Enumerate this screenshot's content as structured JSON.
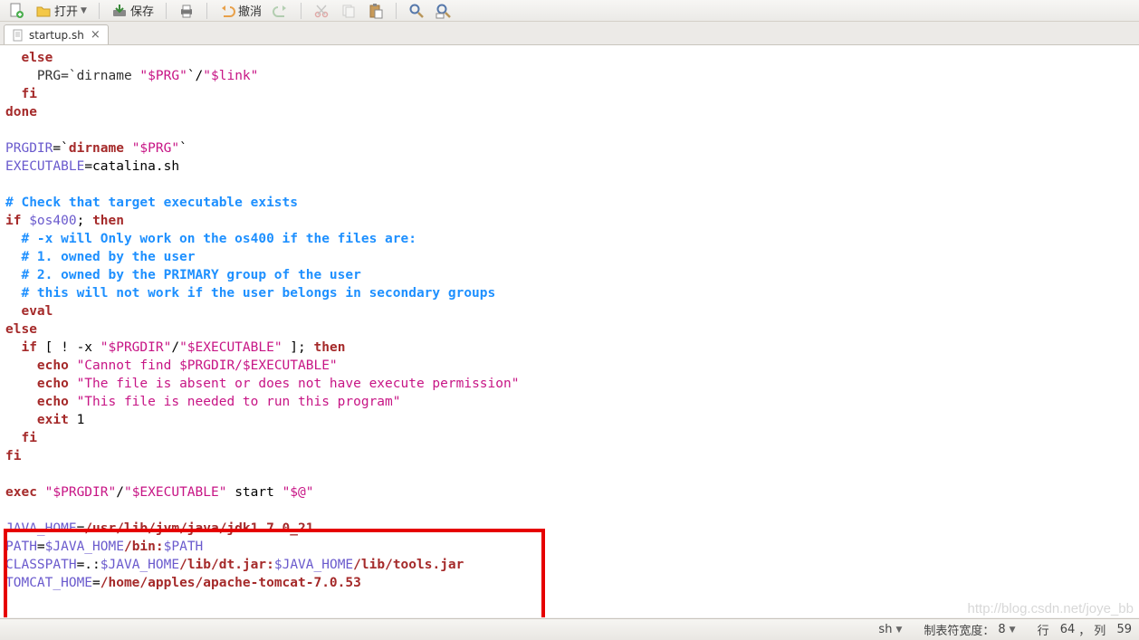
{
  "toolbar": {
    "open_label": "打开",
    "save_label": "保存",
    "undo_label": "撤消"
  },
  "tab": {
    "filename": "startup.sh"
  },
  "code": {
    "l1": "  else",
    "l2_a": "    PRG=`",
    "l2_b": "dirname",
    "l2_c": " ",
    "l2_d": "\"$PRG\"",
    "l2_e": "`/",
    "l2_f": "\"$link\"",
    "l3": "  fi",
    "l4": "done",
    "l5_a": "PRGDIR",
    "l5_b": "=`",
    "l5_c": "dirname",
    "l5_d": " ",
    "l5_e": "\"$PRG\"",
    "l5_f": "`",
    "l6_a": "EXECUTABLE",
    "l6_b": "=catalina.sh",
    "c1": "# Check that target executable exists",
    "l7_a": "if",
    "l7_b": " ",
    "l7_c": "$os400",
    "l7_d": "; ",
    "l7_e": "then",
    "c2": "  # -x will Only work on the os400 if the files are:",
    "c3": "  # 1. owned by the user",
    "c4": "  # 2. owned by the PRIMARY group of the user",
    "c5": "  # this will not work if the user belongs in secondary groups",
    "l8": "  eval",
    "l9": "else",
    "l10_a": "  if",
    "l10_b": " [ ! -x ",
    "l10_c": "\"$PRGDIR\"",
    "l10_d": "/",
    "l10_e": "\"$EXECUTABLE\"",
    "l10_f": " ]; ",
    "l10_g": "then",
    "l11_a": "    echo",
    "l11_b": " ",
    "l11_c": "\"Cannot find $PRGDIR/$EXECUTABLE\"",
    "l12_a": "    echo",
    "l12_b": " ",
    "l12_c": "\"The file is absent or does not have execute permission\"",
    "l13_a": "    echo",
    "l13_b": " ",
    "l13_c": "\"This file is needed to run this program\"",
    "l14_a": "    exit",
    "l14_b": " 1",
    "l15": "  fi",
    "l16": "fi",
    "l17_a": "exec",
    "l17_b": " ",
    "l17_c": "\"$PRGDIR\"",
    "l17_d": "/",
    "l17_e": "\"$EXECUTABLE\"",
    "l17_f": " start ",
    "l17_g": "\"$@\"",
    "e1_a": "JAVA_HOME",
    "e1_b": "=",
    "e1_c": "/usr/lib/jvm/java/jdk1.7.0_21",
    "e2_a": "PATH",
    "e2_b": "=",
    "e2_c": "$JAVA_HOME",
    "e2_d": "/bin:",
    "e2_e": "$PATH",
    "e3_a": "CLASSPATH",
    "e3_b": "=.:",
    "e3_c": "$JAVA_HOME",
    "e3_d": "/lib/dt.jar:",
    "e3_e": "$JAVA_HOME",
    "e3_f": "/lib/tools.jar",
    "e4_a": "TOMCAT_HOME",
    "e4_b": "=",
    "e4_c": "/home/apples/apache-tomcat-7.0.53"
  },
  "status": {
    "lang": "sh",
    "tabwidth_label": "制表符宽度：",
    "tabwidth_value": "8",
    "line_label": "行",
    "line_value": "64",
    "col_label": "列",
    "col_value": "59"
  },
  "watermark": "http://blog.csdn.net/joye_bb"
}
